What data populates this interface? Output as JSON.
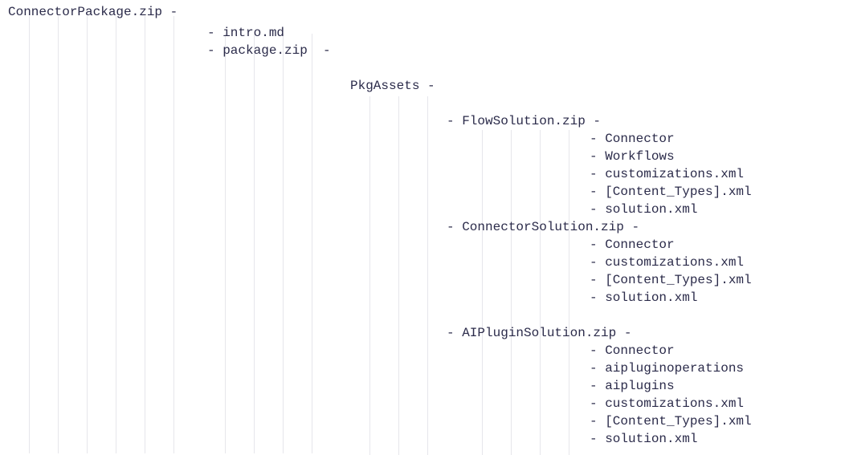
{
  "root": "ConnectorPackage.zip -",
  "intro": "- intro.md",
  "package": "- package.zip  -",
  "pkgassets": "PkgAssets -",
  "flowsol": "- FlowSolution.zip -",
  "fs_connector": "- Connector",
  "fs_workflows": "- Workflows",
  "fs_custom": "- customizations.xml",
  "fs_content": "- [Content_Types].xml",
  "fs_solution": "- solution.xml",
  "connsol": "- ConnectorSolution.zip -",
  "cs_connector": "- Connector",
  "cs_custom": "- customizations.xml",
  "cs_content": "- [Content_Types].xml",
  "cs_solution": "- solution.xml",
  "aisol": "- AIPluginSolution.zip -",
  "ai_connector": "- Connector",
  "ai_ops": "- aipluginoperations",
  "ai_plugins": "- aiplugins",
  "ai_custom": "- customizations.xml",
  "ai_content": "- [Content_Types].xml",
  "ai_solution": "- solution.xml"
}
